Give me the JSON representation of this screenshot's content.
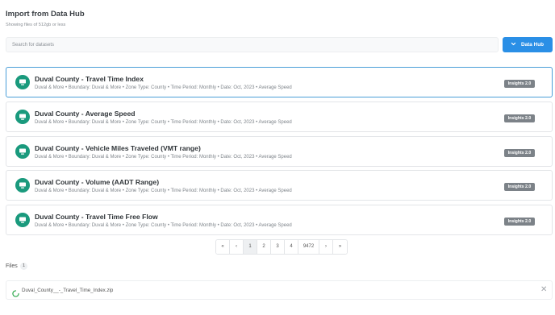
{
  "header": {
    "title": "Import from Data Hub",
    "subtitle": "Showing files of 512gb or less"
  },
  "search": {
    "placeholder": "Search for datasets"
  },
  "data_hub_button": {
    "label": "Data Hub",
    "icon": "chevron-down-icon"
  },
  "datasets": [
    {
      "title": "Duval County - Travel Time Index",
      "description": "Duval & More • Boundary: Duval & More • Zone Type: County • Time Period: Monthly • Date: Oct, 2023 • Average Speed",
      "badge": "Insights 2.0",
      "selected": true
    },
    {
      "title": "Duval County - Average Speed",
      "description": "Duval & More • Boundary: Duval & More • Zone Type: County • Time Period: Monthly • Date: Oct, 2023 • Average Speed",
      "badge": "Insights 2.0",
      "selected": false
    },
    {
      "title": "Duval County - Vehicle Miles Traveled (VMT range)",
      "description": "Duval & More • Boundary: Duval & More • Zone Type: County • Time Period: Monthly • Date: Oct, 2023 • Average Speed",
      "badge": "Insights 2.0",
      "selected": false
    },
    {
      "title": "Duval County - Volume (AADT Range)",
      "description": "Duval & More • Boundary: Duval & More • Zone Type: County • Time Period: Monthly • Date: Oct, 2023 • Average Speed",
      "badge": "Insights 2.0",
      "selected": false
    },
    {
      "title": "Duval County - Travel Time Free Flow",
      "description": "Duval & More • Boundary: Duval & More • Zone Type: County • Time Period: Monthly • Date: Oct, 2023 • Average Speed",
      "badge": "Insights 2.0",
      "selected": false
    }
  ],
  "pagination": {
    "first": "«",
    "prev": "‹",
    "pages": [
      "1",
      "2",
      "3",
      "4",
      "9472"
    ],
    "current": "1",
    "next": "›",
    "last": "»"
  },
  "files": {
    "label": "Files",
    "count": "1",
    "items": [
      {
        "name": "Duval_County__-_Travel_Time_Index.zip",
        "status_icon": "loading-spinner-icon",
        "remove_icon": "close-icon"
      }
    ]
  },
  "colors": {
    "accent": "#2a8fe6",
    "dataset_icon": "#1a9a7d",
    "badge": "#7c8288",
    "selected_border": "#4a9ed8"
  }
}
